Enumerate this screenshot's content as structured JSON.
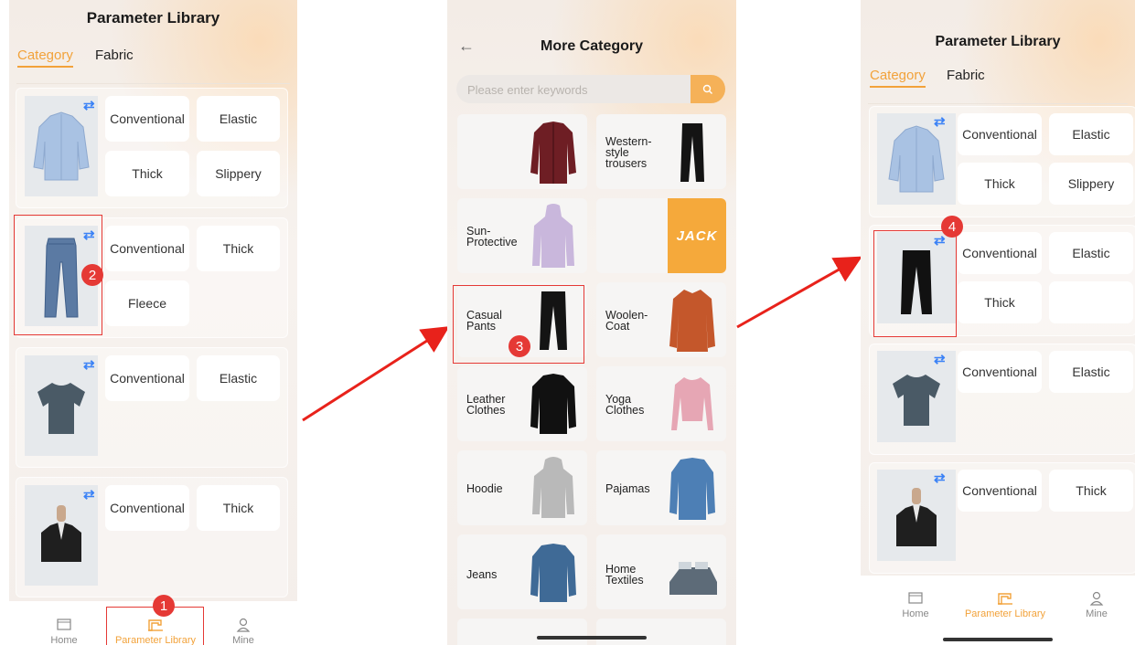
{
  "screen1": {
    "title": "Parameter Library",
    "tabs": [
      "Category",
      "Fabric"
    ],
    "rows": [
      {
        "icon": "shirt",
        "chips": [
          "Conventional",
          "Elastic",
          "Thick",
          "Slippery"
        ]
      },
      {
        "icon": "jeans",
        "chips": [
          "Conventional",
          "Thick",
          "Fleece"
        ]
      },
      {
        "icon": "tshirt",
        "chips": [
          "Conventional",
          "Elastic"
        ]
      },
      {
        "icon": "suit",
        "chips": [
          "Conventional",
          "Thick"
        ]
      }
    ],
    "nav": [
      "Home",
      "Parameter Library",
      "Mine"
    ],
    "badges": {
      "one": "1",
      "two": "2"
    }
  },
  "screen2": {
    "title": "More Category",
    "search": {
      "placeholder": "Please enter keywords",
      "value": ""
    },
    "categories": [
      {
        "label": "",
        "icon": "jacket-maroon"
      },
      {
        "label": "Western-\nstyle\ntrousers",
        "icon": "trousers-black"
      },
      {
        "label": "Sun-\nProtective",
        "icon": "hoodie-lilac"
      },
      {
        "label": "JACK",
        "icon": "jack-logo"
      },
      {
        "label": "Casual\nPants",
        "icon": "pants-black"
      },
      {
        "label": "Woolen-\nCoat",
        "icon": "coat-orange"
      },
      {
        "label": "Leather\nClothes",
        "icon": "leather-jacket"
      },
      {
        "label": "Yoga\nClothes",
        "icon": "yoga-top"
      },
      {
        "label": "Hoodie",
        "icon": "hoodie-grey"
      },
      {
        "label": "Pajamas",
        "icon": "pajamas-blue"
      },
      {
        "label": "Jeans",
        "icon": "denim-jacket"
      },
      {
        "label": "Home\nTextiles",
        "icon": "bedding"
      }
    ],
    "badges": {
      "three": "3"
    }
  },
  "screen3": {
    "title": "Parameter Library",
    "tabs": [
      "Category",
      "Fabric"
    ],
    "rows": [
      {
        "icon": "shirt",
        "chips": [
          "Conventional",
          "Elastic",
          "Thick",
          "Slippery"
        ]
      },
      {
        "icon": "pants",
        "chips": [
          "Conventional",
          "Elastic",
          "Thick"
        ]
      },
      {
        "icon": "tshirt",
        "chips": [
          "Conventional",
          "Elastic"
        ]
      },
      {
        "icon": "suit",
        "chips": [
          "Conventional",
          "Thick"
        ]
      }
    ],
    "nav": [
      "Home",
      "Parameter Library",
      "Mine"
    ],
    "badges": {
      "four": "4"
    }
  },
  "colors": {
    "accent": "#f2a23a",
    "annotation": "#e53935",
    "swap": "#3b82f6"
  }
}
